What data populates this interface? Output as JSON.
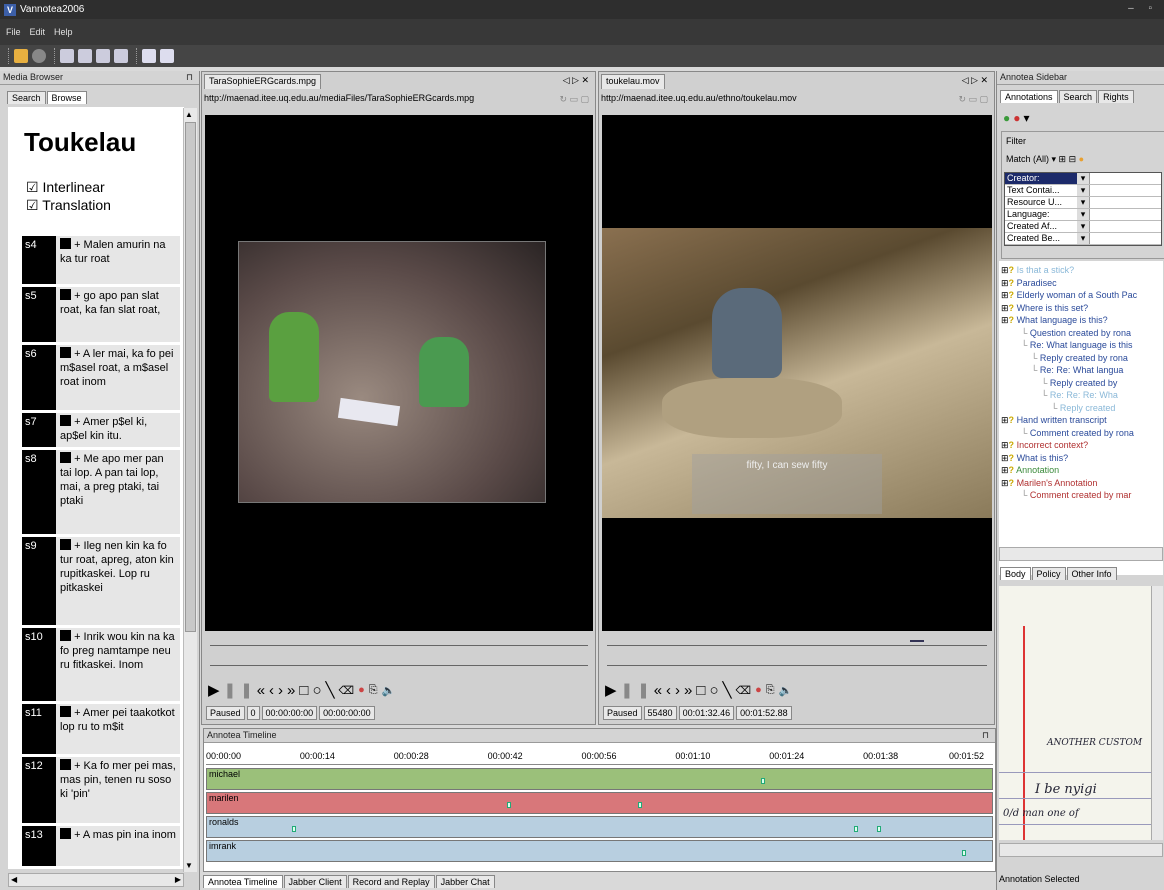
{
  "app": {
    "title": "Vannotea2006"
  },
  "menu": [
    "File",
    "Edit",
    "Help"
  ],
  "media_browser": {
    "title": "Media Browser",
    "tabs": [
      "Search",
      "Browse"
    ],
    "heading": "Toukelau",
    "options": [
      "Interlinear",
      "Translation"
    ],
    "sentences": [
      {
        "id": "s4",
        "text": "+ Malen amurin na ka tur roat"
      },
      {
        "id": "s5",
        "text": "+ go apo pan slat roat, ka fan slat roat,"
      },
      {
        "id": "s6",
        "text": "+ A ler mai, ka fo pei m$asel roat, a m$asel roat inom"
      },
      {
        "id": "s7",
        "text": "+ Amer p$el ki, ap$el kin itu."
      },
      {
        "id": "s8",
        "text": "+ Me apo mer pan tai lop. A pan tai lop, mai, a preg ptaki, tai ptaki"
      },
      {
        "id": "s9",
        "text": "+ Ileg nen kin ka fo tur roat, apreg, aton kin rupitkaskei. Lop ru pitkaskei"
      },
      {
        "id": "s10",
        "text": "+ Inrik wou kin na ka fo preg namtampe neu ru fitkaskei. Inom"
      },
      {
        "id": "s11",
        "text": "+ Amer pei taakotkot lop ru to m$it"
      },
      {
        "id": "s12",
        "text": "+ Ka fo mer pei mas, mas pin, tenen ru soso ki 'pin'"
      },
      {
        "id": "s13",
        "text": "+ A mas pin ina inom"
      }
    ]
  },
  "video1": {
    "tab": "TaraSophieERGcards.mpg",
    "url": "http://maenad.itee.uq.edu.au/mediaFiles/TaraSophieERGcards.mpg",
    "status": "Paused",
    "frame": "0",
    "time": "00:00:00:00",
    "duration": "00:00:00:00"
  },
  "video2": {
    "tab": "toukelau.mov",
    "url": "http://maenad.itee.uq.edu.au/ethno/toukelau.mov",
    "status": "Paused",
    "frame": "55480",
    "time": "00:01:32.46",
    "duration": "00:01:52.88",
    "subtitle": "fifty, I can sew fifty",
    "progress": 0.82
  },
  "timeline": {
    "title": "Annotea Timeline",
    "ticks": [
      "00:00:00",
      "00:00:14",
      "00:00:28",
      "00:00:42",
      "00:00:56",
      "00:01:10",
      "00:01:24",
      "00:01:38",
      "00:01:52"
    ],
    "tracks": [
      {
        "name": "michael",
        "color": "#9bc07a"
      },
      {
        "name": "marilen",
        "color": "#d8777a"
      },
      {
        "name": "ronalds",
        "color": "#b8cfe0"
      },
      {
        "name": "imrank",
        "color": "#b8cfe0"
      }
    ]
  },
  "bottom_tabs": [
    "Annotea Timeline",
    "Jabber Client",
    "Record and Replay",
    "Jabber Chat"
  ],
  "sidebar": {
    "title": "Annotea Sidebar",
    "tabs": [
      "Annotations",
      "Search",
      "Rights"
    ],
    "filter_label": "Filter",
    "match": "Match (All)",
    "filters": [
      "Creator:",
      "Text Contai...",
      "Resource U...",
      "Language:",
      "Created Af...",
      "Created Be..."
    ],
    "tree": [
      {
        "label": "Is that a stick?",
        "color": "#8ab8d8"
      },
      {
        "label": "Paradisec",
        "color": "#2a4a9a"
      },
      {
        "label": "Elderly woman of a South Pac",
        "color": "#2a4a9a"
      },
      {
        "label": "Where is this set?",
        "color": "#2a4a9a"
      },
      {
        "label": "What language is this?",
        "color": "#2a4a9a"
      },
      {
        "label": "Question created by rona",
        "color": "#2a4a9a"
      },
      {
        "label": "Re: What language is this",
        "color": "#2a4a9a"
      },
      {
        "label": "Reply created by rona",
        "color": "#2a4a9a"
      },
      {
        "label": "Re: Re: What langua",
        "color": "#2a4a9a"
      },
      {
        "label": "Reply created by",
        "color": "#2a4a9a"
      },
      {
        "label": "Re: Re: Re: Wha",
        "color": "#8ab8d8"
      },
      {
        "label": "Reply created",
        "color": "#8ab8d8"
      },
      {
        "label": "Hand written transcript",
        "color": "#2a4a9a"
      },
      {
        "label": "Comment created by rona",
        "color": "#2a4a9a"
      },
      {
        "label": "Incorrect context?",
        "color": "#b03030"
      },
      {
        "label": "What is this?",
        "color": "#2a4a9a"
      },
      {
        "label": "Annotation",
        "color": "#3a8a3a"
      },
      {
        "label": "Marilen's Annotation",
        "color": "#b03030"
      },
      {
        "label": "Comment created by mar",
        "color": "#b03030"
      }
    ],
    "body_tabs": [
      "Body",
      "Policy",
      "Other Info"
    ],
    "handwriting": [
      "ANOTHER CUSTOM",
      "I be nyigi",
      "0/d man one of"
    ],
    "status": "Annotation Selected"
  }
}
